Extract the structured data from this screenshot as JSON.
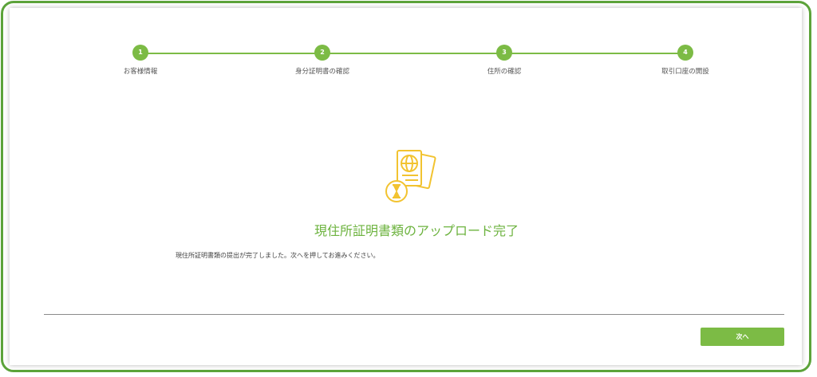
{
  "stepper": {
    "steps": [
      {
        "number": "1",
        "label": "お客様情報"
      },
      {
        "number": "2",
        "label": "身分証明書の確認"
      },
      {
        "number": "3",
        "label": "住所の確認"
      },
      {
        "number": "4",
        "label": "取引口座の開設"
      }
    ]
  },
  "main": {
    "icon": "passport-hourglass-icon",
    "title": "現住所証明書類のアップロード完了",
    "message": "現住所証明書類の提出が完了しました。次へを押してお進みください。"
  },
  "footer": {
    "next_label": "次へ"
  },
  "colors": {
    "accent": "#7cbb45",
    "title": "#6db33f",
    "icon": "#f2c330",
    "frame": "#5ca33a"
  }
}
